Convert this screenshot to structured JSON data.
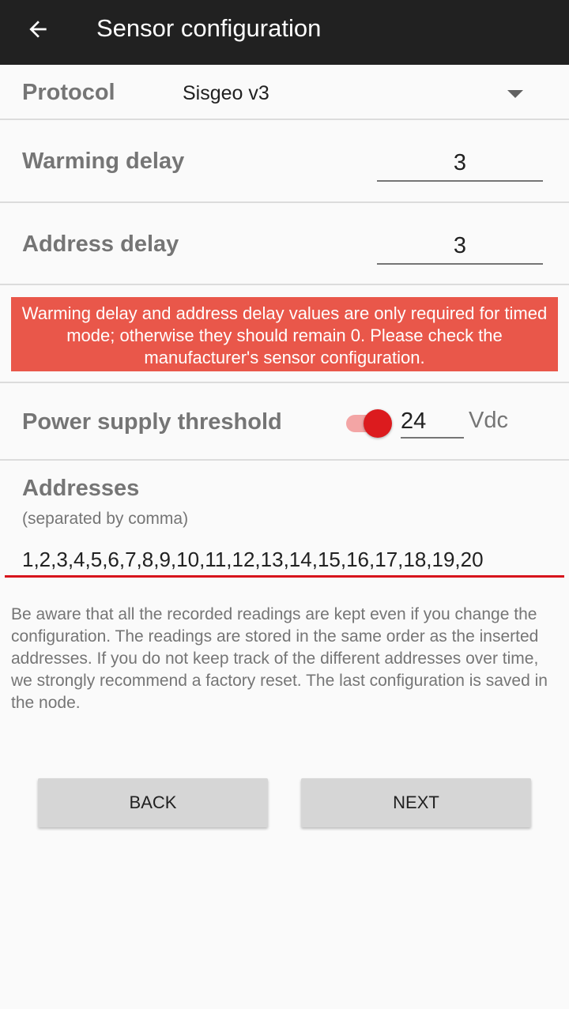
{
  "appbar": {
    "title": "Sensor configuration",
    "back_icon": "arrow-left-icon"
  },
  "protocol": {
    "label": "Protocol",
    "value": "Sisgeo v3",
    "dropdown_icon": "triangle-down-icon"
  },
  "warming_delay": {
    "label": "Warming delay",
    "value": "3"
  },
  "address_delay": {
    "label": "Address delay",
    "value": "3"
  },
  "warning": {
    "text": "Warming delay and address delay values are only required for timed mode; otherwise they should remain 0. Please check the manufacturer's sensor configuration.",
    "color": "#e9574a"
  },
  "power_supply": {
    "label": "Power supply threshold",
    "switch_on": true,
    "value": "24",
    "unit": "Vdc"
  },
  "addresses": {
    "label": "Addresses",
    "hint": "(separated by comma)",
    "value": "1,2,3,4,5,6,7,8,9,10,11,12,13,14,15,16,17,18,19,20",
    "accent_color": "#d7141c"
  },
  "note": "Be aware that all the recorded readings are kept even if you change the configuration. The readings are stored in the same order as the inserted addresses. If you do not keep track of the different addresses over time, we strongly recommend a factory reset. The last configuration is saved in the node.",
  "buttons": {
    "back": "BACK",
    "next": "NEXT"
  }
}
